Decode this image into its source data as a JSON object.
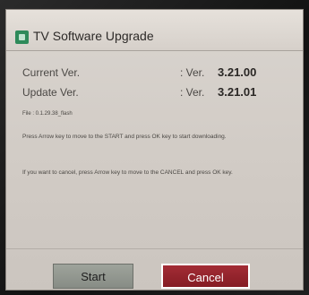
{
  "dialog": {
    "title": "TV Software Upgrade",
    "icon": "upgrade-app-icon",
    "current_version": {
      "label": "Current Ver.",
      "prefix": ": Ver.",
      "value": "3.21.00"
    },
    "update_version": {
      "label": "Update Ver.",
      "prefix": ": Ver.",
      "value": "3.21.01"
    },
    "file_info": "File : 0.1.29.38_flash",
    "message_start": "Press Arrow key to move to the START and press OK key to start downloading.",
    "message_cancel": "If you want to cancel, press Arrow key to move to the CANCEL and press OK key.",
    "buttons": {
      "start": "Start",
      "cancel": "Cancel"
    },
    "colors": {
      "dialog_bg": "#d2ccc6",
      "start_button": "#8f948d",
      "cancel_button": "#961f29",
      "focus_border": "#ffffff"
    },
    "focused_button": "cancel"
  }
}
